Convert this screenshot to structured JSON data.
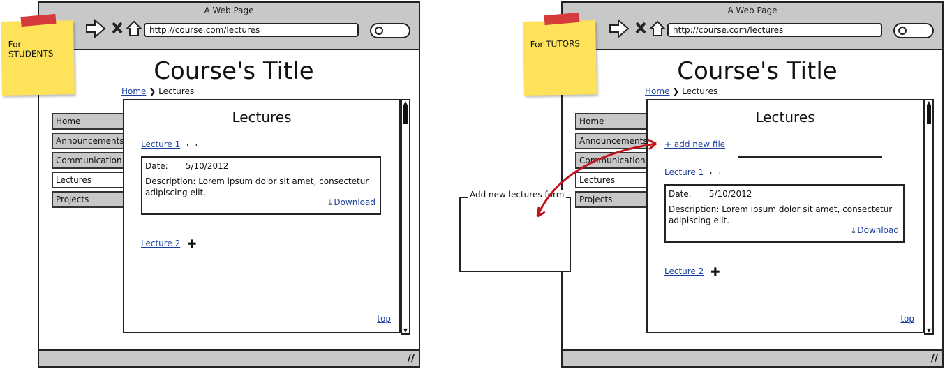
{
  "students_view": {
    "sticky_note": "For\nSTUDENTS",
    "window_title": "A Web Page",
    "url": "http://course.com/lectures",
    "page_title": "Course's Title",
    "breadcrumb": {
      "home": "Home",
      "current": "Lectures"
    },
    "nav": [
      "Home",
      "Announcements",
      "Communication",
      "Lectures",
      "Projects"
    ],
    "content_title": "Lectures",
    "lecture1": {
      "label": "Lecture 1",
      "date_label": "Date:",
      "date": "5/10/2012",
      "description": "Description: Lorem ipsum dolor sit amet, consectetur adipiscing elit.",
      "download": "Download"
    },
    "lecture2": {
      "label": "Lecture 2"
    },
    "top_link": "top"
  },
  "tutors_view": {
    "sticky_note": "For TUTORS",
    "window_title": "A Web Page",
    "url": "http://course.com/lectures",
    "page_title": "Course's Title",
    "breadcrumb": {
      "home": "Home",
      "current": "Lectures"
    },
    "nav": [
      "Home",
      "Announcements",
      "Communication",
      "Lectures",
      "Projects"
    ],
    "content_title": "Lectures",
    "add_file": "+ add new file",
    "lecture1": {
      "label": "Lecture 1",
      "date_label": "Date:",
      "date": "5/10/2012",
      "description": "Description: Lorem ipsum dolor sit amet, consectetur adipiscing elit.",
      "download": "Download"
    },
    "lecture2": {
      "label": "Lecture 2"
    },
    "top_link": "top"
  },
  "annotation": {
    "form_label": "Add new lectures form"
  },
  "colors": {
    "link": "#1a3f9c",
    "sticky": "#fde25a",
    "tape": "#d63a3a",
    "arrow": "#c0171d",
    "chrome": "#c8c8c8"
  }
}
